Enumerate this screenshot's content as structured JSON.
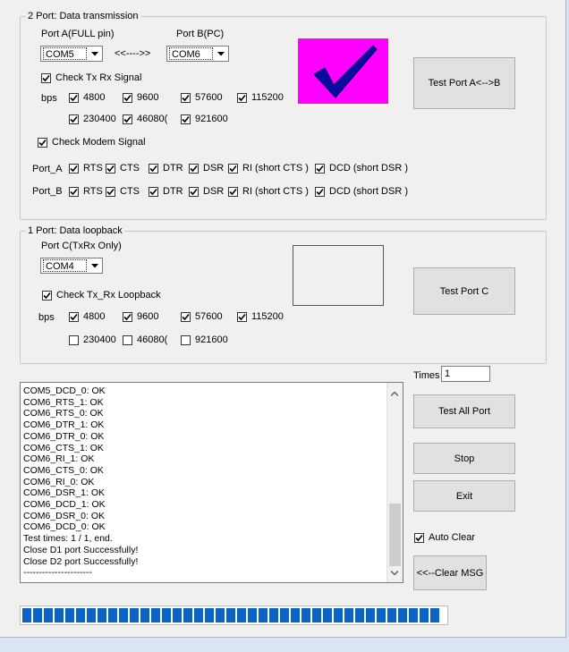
{
  "colors": {
    "window_bg": "#f0f0f0",
    "frame_bg": "#dbe5f1",
    "image_bg": "#ff00ff",
    "check_mark": "#0a0aa0",
    "progress": "#0a63c7"
  },
  "port2": {
    "title": "2 Port: Data transmission",
    "port_a_label": "Port A(FULL pin)",
    "port_b_label": "Port B(PC)",
    "port_a_value": "COM5",
    "port_b_value": "COM6",
    "arrow_text": "<<---->>",
    "result_icon": "check-mark-icon",
    "check_txrx": "Check Tx Rx Signal",
    "bps_label": "bps",
    "bps": [
      "4800",
      "9600",
      "57600",
      "115200",
      "230400",
      "46080(",
      "921600"
    ],
    "check_modem": "Check Modem Signal",
    "port_a_row_label": "Port_A",
    "port_b_row_label": "Port_B",
    "signals": [
      "RTS",
      "CTS",
      "DTR",
      "DSR",
      "RI (short CTS )",
      "DCD (short DSR )"
    ],
    "test_button": "Test Port A<-->B"
  },
  "port1": {
    "title": "1 Port: Data loopback",
    "port_c_label": "Port C(TxRx Only)",
    "port_c_value": "COM4",
    "check_loopback": "Check Tx_Rx Loopback",
    "bps_label": "bps",
    "bps": [
      "4800",
      "9600",
      "57600",
      "115200",
      "230400",
      "46080(",
      "921600"
    ],
    "test_button": "Test Port C"
  },
  "controls": {
    "times_label": "Times",
    "times_value": "1",
    "test_all": "Test All Port",
    "stop": "Stop",
    "exit": "Exit",
    "auto_clear": "Auto Clear",
    "clear_msg": "<<--Clear MSG"
  },
  "log": [
    "COM5_DCD_0: OK",
    "COM6_RTS_1: OK",
    "COM6_RTS_0: OK",
    "COM6_DTR_1: OK",
    "COM6_DTR_0: OK",
    "COM6_CTS_1: OK",
    "COM6_RI_1: OK",
    "COM6_CTS_0: OK",
    "COM6_RI_0: OK",
    "COM6_DSR_1: OK",
    "COM6_DCD_1: OK",
    "COM6_DSR_0: OK",
    "COM6_DCD_0: OK",
    "Test times: 1 / 1, end.",
    "Close D1 port Successfully!",
    "Close D2 port Successfully!",
    "----------------------"
  ],
  "progress_fraction": 0.99
}
